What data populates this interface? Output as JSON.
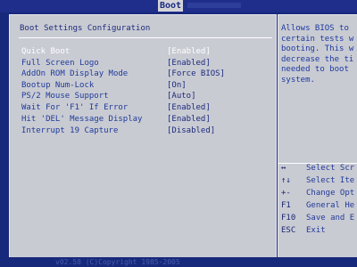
{
  "top_tab": "Boot",
  "left": {
    "title": "Boot Settings Configuration",
    "rows": [
      {
        "label": "Quick Boot",
        "value": "[Enabled]",
        "selected": true
      },
      {
        "label": "Full Screen Logo",
        "value": "[Enabled]"
      },
      {
        "label": "AddOn ROM Display Mode",
        "value": "[Force BIOS]"
      },
      {
        "label": "Bootup Num-Lock",
        "value": "[On]"
      },
      {
        "label": "PS/2 Mouse Support",
        "value": "[Auto]"
      },
      {
        "label": "Wait For 'F1' If Error",
        "value": "[Enabled]"
      },
      {
        "label": "Hit 'DEL' Message Display",
        "value": "[Enabled]"
      },
      {
        "label": "Interrupt 19 Capture",
        "value": "[Disabled]"
      }
    ]
  },
  "help": {
    "lines": [
      "Allows BIOS to",
      "certain tests w",
      "booting. This w",
      "decrease the ti",
      "needed to boot",
      "system."
    ]
  },
  "keys": [
    {
      "key": "↔",
      "desc": "Select Scr"
    },
    {
      "key": "↑↓",
      "desc": "Select Ite"
    },
    {
      "key": "+-",
      "desc": "Change Opt"
    },
    {
      "key": "F1",
      "desc": "General He"
    },
    {
      "key": "F10",
      "desc": "Save and E"
    },
    {
      "key": "ESC",
      "desc": "Exit"
    }
  ],
  "footer": "v02.58 (C)Copyright 1985-2005"
}
